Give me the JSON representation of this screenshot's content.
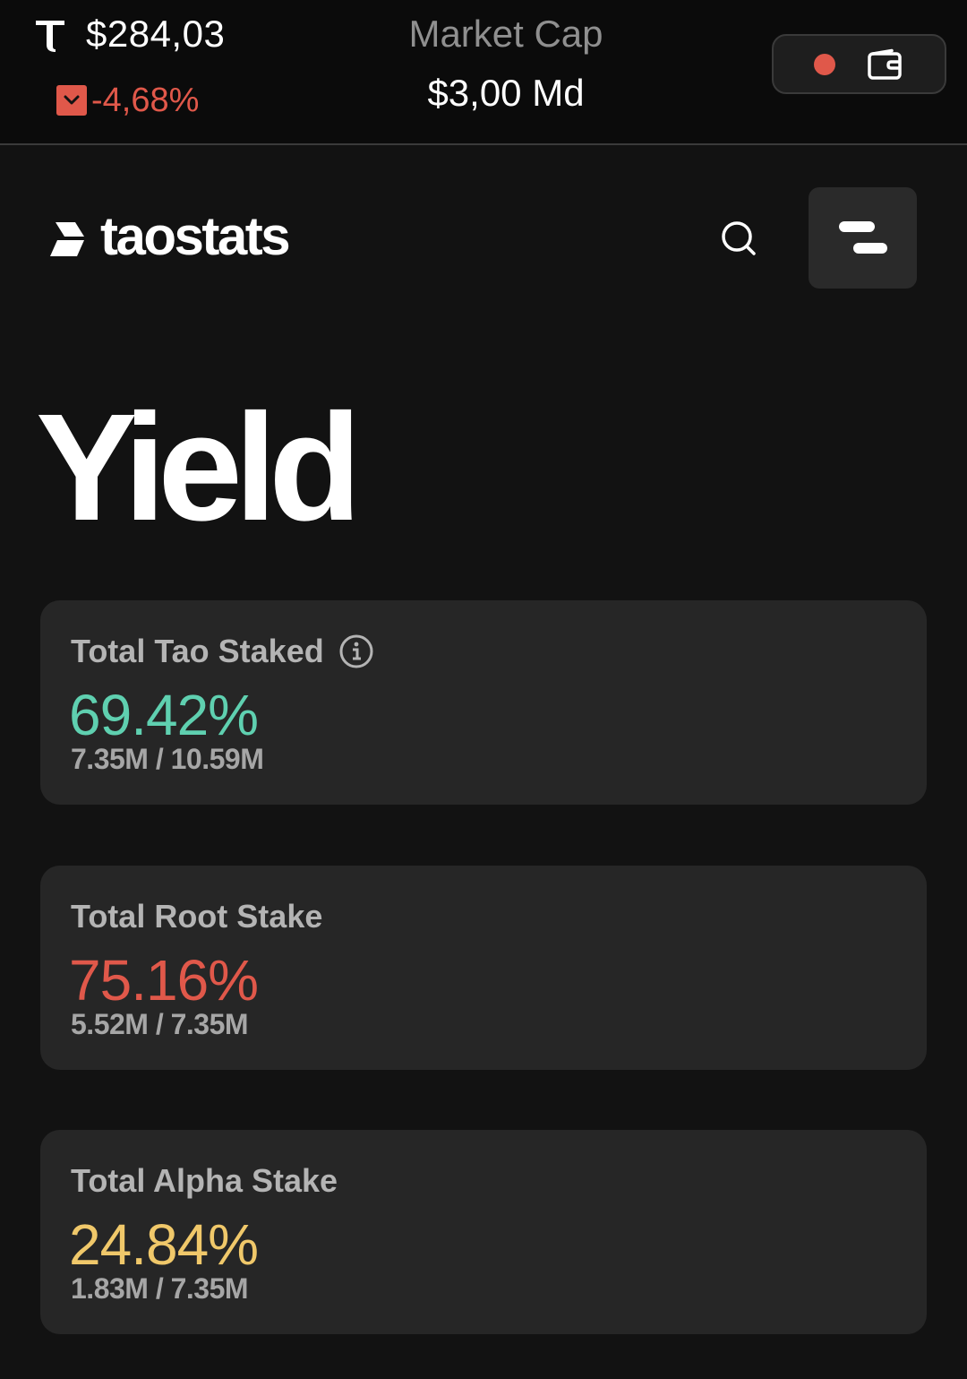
{
  "ticker": {
    "symbol_icon": "tao-symbol-icon",
    "price": "$284,03",
    "change": "-4,68%",
    "change_icon": "chevron-down-icon",
    "market_cap_label": "Market Cap",
    "market_cap_value": "$3,00 Md",
    "status_color": "#e0584a",
    "wallet_icon": "wallet-icon"
  },
  "header": {
    "logo_text": "taostats",
    "search_icon": "search-icon",
    "menu_icon": "menu-icon"
  },
  "page": {
    "title": "Yield"
  },
  "cards": [
    {
      "title": "Total Tao Staked",
      "has_info": true,
      "percent": "69.42%",
      "detail": "7.35M / 10.59M",
      "color": "#5fd0b0"
    },
    {
      "title": "Total Root Stake",
      "has_info": false,
      "percent": "75.16%",
      "detail": "5.52M / 7.35M",
      "color": "#e0584a"
    },
    {
      "title": "Total Alpha Stake",
      "has_info": false,
      "percent": "24.84%",
      "detail": "1.83M / 7.35M",
      "color": "#f0c86a"
    }
  ],
  "colors": {
    "background": "#121212",
    "card": "#262626",
    "positive": "#5fd0b0",
    "negative": "#e0584a",
    "accent_yellow": "#f0c86a"
  }
}
